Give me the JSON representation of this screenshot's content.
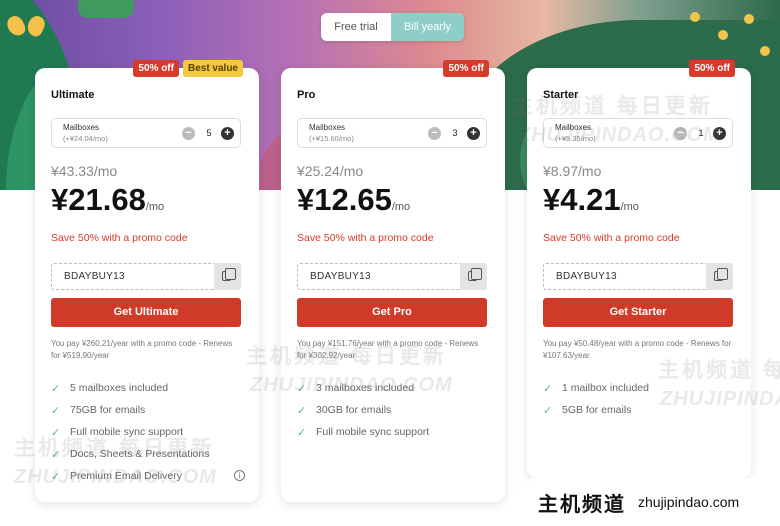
{
  "billing_toggle": {
    "free_label": "Free trial",
    "yearly_label": "Bill yearly",
    "selected": "yearly"
  },
  "colors": {
    "accent": "#d03a28",
    "toggle_active": "#8fcdc8",
    "best_value": "#f4c842",
    "check": "#5fb1ad"
  },
  "plans": [
    {
      "name": "Ultimate",
      "badges": [
        "50% off",
        "Best value"
      ],
      "mailbox_label": "Mailboxes",
      "mailbox_sub": "(+¥24.04/mo)",
      "qty": "5",
      "old_price": "¥43.33/mo",
      "price": "¥21.68",
      "per": "/mo",
      "promo_note": "Save 50% with a promo code",
      "code": "BDAYBUY13",
      "cta": "Get Ultimate",
      "pay_note": "You pay ¥260.21/year with a promo code - Renews for ¥519.90/year",
      "features": [
        "5 mailboxes included",
        "75GB for emails",
        "Full mobile sync support",
        "Docs, Sheets & Presentations",
        "Premium Email Delivery"
      ]
    },
    {
      "name": "Pro",
      "badges": [
        "50% off"
      ],
      "mailbox_label": "Mailboxes",
      "mailbox_sub": "(+¥15.60/mo)",
      "qty": "3",
      "old_price": "¥25.24/mo",
      "price": "¥12.65",
      "per": "/mo",
      "promo_note": "Save 50% with a promo code",
      "code": "BDAYBUY13",
      "cta": "Get Pro",
      "pay_note": "You pay ¥151.76/year with a promo code - Renews for ¥302.92/year",
      "features": [
        "3 mailboxes included",
        "30GB for emails",
        "Full mobile sync support"
      ]
    },
    {
      "name": "Starter",
      "badges": [
        "50% off"
      ],
      "mailbox_label": "Mailboxes",
      "mailbox_sub": "(+¥5.35/mo)",
      "qty": "1",
      "old_price": "¥8.97/mo",
      "price": "¥4.21",
      "per": "/mo",
      "promo_note": "Save 50% with a promo code",
      "code": "BDAYBUY13",
      "cta": "Get Starter",
      "pay_note": "You pay ¥50.48/year with a promo code - Renews for ¥107.63/year",
      "features": [
        "1 mailbox included",
        "5GB for emails"
      ]
    }
  ],
  "watermark": {
    "cn": "主机频道 每日更新",
    "cn_short": "主机频道",
    "url": "ZHUJIPINDAO.COM",
    "url_lower": "zhujipindao.com"
  }
}
